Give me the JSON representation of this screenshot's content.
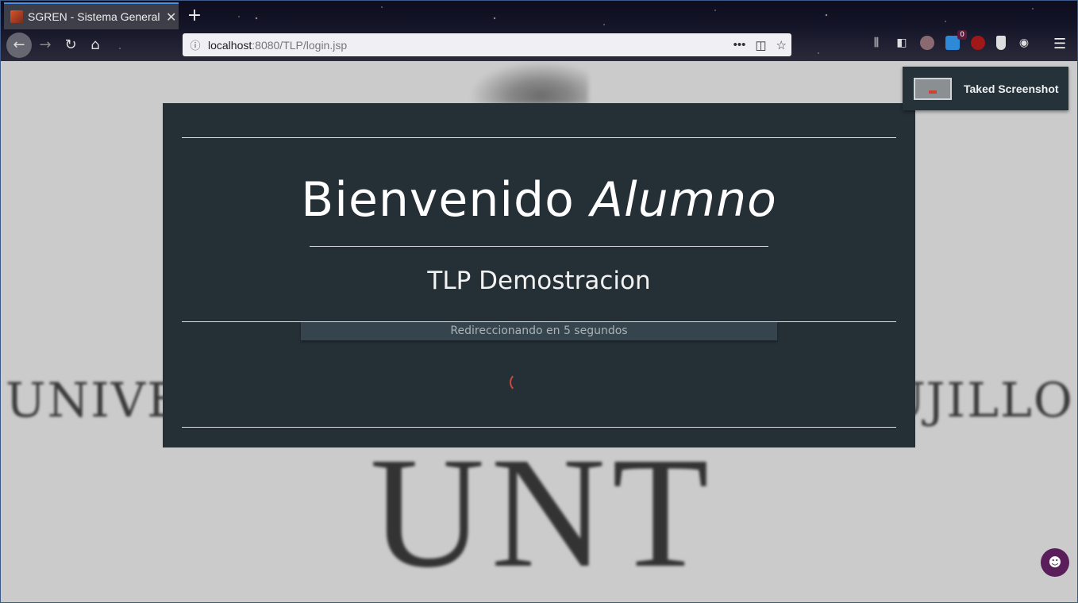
{
  "browser": {
    "tab_title": "SGREN - Sistema General",
    "tab_close": "✕",
    "new_tab": "+",
    "url_host": "localhost",
    "url_path": ":8080/TLP/login.jsp",
    "back_icon": "←",
    "forward_icon": "→",
    "reload_icon": "↻",
    "home_icon": "⌂",
    "page_actions_icon": "•••",
    "pocket_icon": "◫",
    "bookmark_icon": "☆",
    "menu_icon": "☰",
    "extension_badge": "0",
    "icons": [
      "library-icon",
      "sidebar-icon",
      "avatar-icon",
      "extension-icon",
      "ublock-icon",
      "shield-icon",
      "mask-icon"
    ]
  },
  "page": {
    "welcome_word": "Bienvenido",
    "welcome_role": "Alumno",
    "subtitle": "TLP Demostracion",
    "redirect_text": "Redireccionando en 5 segundos",
    "background_left": "UNIVE",
    "background_right": "UJILLO",
    "background_logo": "UNT"
  },
  "toast": {
    "label": "Taked Screenshot"
  },
  "floating_button_icon": "ghost-icon",
  "colors": {
    "card": "#252f36",
    "page_bg": "#cbcbcb",
    "spinner": "#d04a3a"
  }
}
